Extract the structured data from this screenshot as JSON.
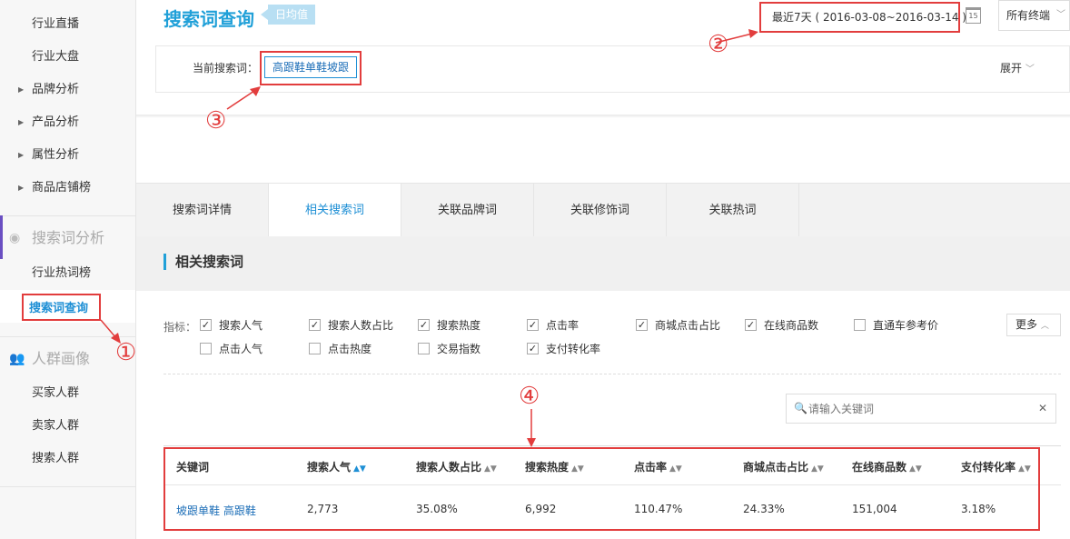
{
  "sidebar": {
    "items_top": [
      "行业直播",
      "行业大盘",
      "品牌分析",
      "产品分析",
      "属性分析",
      "商品店铺榜"
    ],
    "group_search": "搜索词分析",
    "search_items": [
      "行业热词榜",
      "搜索词查询"
    ],
    "group_crowd": "人群画像",
    "crowd_items": [
      "买家人群",
      "卖家人群",
      "搜索人群"
    ]
  },
  "header": {
    "title": "搜索词查询",
    "badge": "日均值",
    "date_range": "最近7天 ( 2016-03-08~2016-03-14 )",
    "calendar_day": "15",
    "terminal": "所有终端"
  },
  "search_card": {
    "label": "当前搜索词：",
    "term": "高跟鞋单鞋坡跟",
    "expand": "展开"
  },
  "tabs": [
    "搜索词详情",
    "相关搜索词",
    "关联品牌词",
    "关联修饰词",
    "关联热词"
  ],
  "section_title": "相关搜索词",
  "metrics": {
    "label": "指标：",
    "options": [
      {
        "label": "搜索人气",
        "checked": true
      },
      {
        "label": "搜索人数占比",
        "checked": true
      },
      {
        "label": "搜索热度",
        "checked": true
      },
      {
        "label": "点击率",
        "checked": true
      },
      {
        "label": "商城点击占比",
        "checked": true
      },
      {
        "label": "在线商品数",
        "checked": true
      },
      {
        "label": "直通车参考价",
        "checked": false
      },
      {
        "label": "点击人气",
        "checked": false
      },
      {
        "label": "点击热度",
        "checked": false
      },
      {
        "label": "交易指数",
        "checked": false
      },
      {
        "label": "支付转化率",
        "checked": true
      }
    ],
    "more": "更多"
  },
  "keyword_search": {
    "placeholder": "请输入关键词"
  },
  "table": {
    "headers": [
      "关键词",
      "搜索人气",
      "搜索人数占比",
      "搜索热度",
      "点击率",
      "商城点击占比",
      "在线商品数",
      "支付转化率"
    ],
    "rows": [
      [
        "坡跟单鞋 高跟鞋",
        "2,773",
        "35.08%",
        "6,992",
        "110.47%",
        "24.33%",
        "151,004",
        "3.18%"
      ]
    ]
  },
  "annotations": [
    "①",
    "②",
    "③",
    "④"
  ],
  "colors": {
    "accent": "#1e8fd5",
    "highlight": "#e23d3d",
    "title": "#20a0d8"
  }
}
